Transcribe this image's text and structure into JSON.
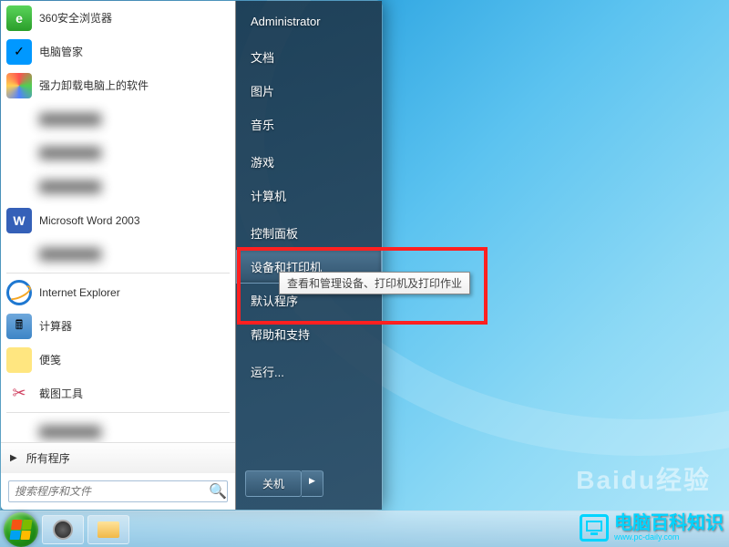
{
  "start_menu": {
    "programs": [
      {
        "label": "360安全浏览器",
        "iconClass": "ic-360",
        "glyph": "e"
      },
      {
        "label": "电脑管家",
        "iconClass": "ic-qq",
        "glyph": "✓"
      },
      {
        "label": "强力卸载电脑上的软件",
        "iconClass": "ic-multi",
        "glyph": ""
      },
      {
        "label": "censored",
        "iconClass": "",
        "glyph": "",
        "censored": true
      },
      {
        "label": "censored 理",
        "iconClass": "",
        "glyph": "",
        "censored": true
      },
      {
        "label": "censored",
        "iconClass": "",
        "glyph": "",
        "censored": true
      },
      {
        "label": "Microsoft Word 2003",
        "iconClass": "ic-word",
        "glyph": "W"
      },
      {
        "label": "censored",
        "iconClass": "",
        "glyph": "",
        "censored": true
      },
      {
        "label": "Internet Explorer",
        "iconClass": "ic-ie",
        "glyph": ""
      },
      {
        "label": "计算器",
        "iconClass": "ic-comp",
        "glyph": "🖩"
      },
      {
        "label": "便笺",
        "iconClass": "ic-notes",
        "glyph": ""
      },
      {
        "label": "截图工具",
        "iconClass": "ic-snip",
        "glyph": ""
      },
      {
        "label": "censored",
        "iconClass": "",
        "glyph": "",
        "censored": true
      }
    ],
    "all_programs": "所有程序",
    "search_placeholder": "搜索程序和文件"
  },
  "right_panel": {
    "user": "Administrator",
    "items": [
      {
        "label": "文档"
      },
      {
        "label": "图片"
      },
      {
        "label": "音乐"
      },
      {
        "label": "游戏"
      },
      {
        "label": "计算机"
      },
      {
        "label": "控制面板"
      },
      {
        "label": "设备和打印机",
        "highlighted": true
      },
      {
        "label": "默认程序"
      },
      {
        "label": "帮助和支持"
      },
      {
        "label": "运行..."
      }
    ],
    "shutdown": "关机"
  },
  "tooltip": "查看和管理设备、打印机及打印作业",
  "watermark": "Baidu经验",
  "footer": {
    "brand": "电脑百科知识",
    "url": "www.pc-daily.com"
  }
}
